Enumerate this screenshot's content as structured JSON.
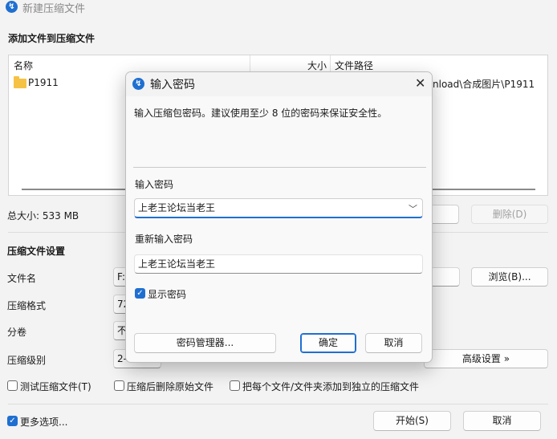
{
  "window": {
    "title": "新建压缩文件"
  },
  "files_section": {
    "title": "添加文件到压缩文件",
    "columns": {
      "name": "名称",
      "size": "大小",
      "path": "文件路径"
    },
    "rows": [
      {
        "name": "P1911",
        "path_visible": "nload\\合成图片\\P1911"
      }
    ],
    "total_size": "总大小: 533 MB",
    "delete_button": "删除(D)"
  },
  "settings_section": {
    "title": "压缩文件设置",
    "filename_label": "文件名",
    "filename_value": "F:\\",
    "browse_button": "浏览(B)...",
    "format_label": "压缩格式",
    "format_value": "72",
    "volume_label": "分卷",
    "volume_value": "不",
    "level_label": "压缩级别",
    "level_value": "2-",
    "advanced_button": "高级设置 »"
  },
  "options": {
    "test_archive": "测试压缩文件(T)",
    "delete_after": "压缩后删除原始文件",
    "separate_archives": "把每个文件/文件夹添加到独立的压缩文件",
    "more_options": "更多选项..."
  },
  "footer": {
    "start_button": "开始(S)",
    "cancel_button": "取消"
  },
  "password_dialog": {
    "title": "输入密码",
    "description": "输入压缩包密码。建议使用至少 8 位的密码来保证安全性。",
    "password_label": "输入密码",
    "password_value": "上老王论坛当老王",
    "reenter_label": "重新输入密码",
    "reenter_value": "上老王论坛当老王",
    "show_password_label": "显示密码",
    "show_password_checked": true,
    "manager_button": "密码管理器...",
    "ok_button": "确定",
    "cancel_button": "取消"
  },
  "colors": {
    "accent": "#1f6fd1",
    "folder": "#f5c244"
  }
}
